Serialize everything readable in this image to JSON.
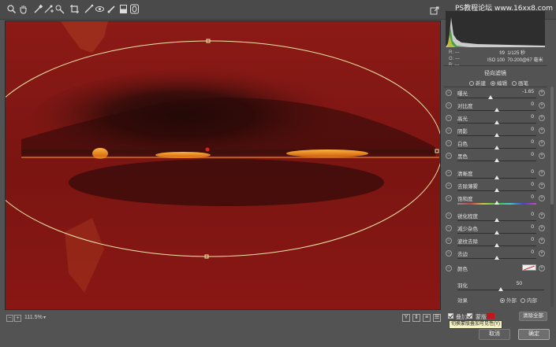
{
  "toolbar": {
    "tools": [
      {
        "icon": "zoom-icon"
      },
      {
        "icon": "hand-icon"
      },
      {
        "icon": "white-balance-icon"
      },
      {
        "icon": "color-sampler-icon"
      },
      {
        "icon": "crop-icon"
      },
      {
        "icon": "straighten-icon"
      },
      {
        "icon": "redeye-icon"
      },
      {
        "icon": "brush-icon"
      },
      {
        "icon": "gradient-filter-icon"
      },
      {
        "icon": "radial-filter-icon"
      }
    ],
    "watermark": "PS教程论坛 www.16xx8.com"
  },
  "info": {
    "r_label": "R:",
    "g_label": "G:",
    "b_label": "B:",
    "r_value": "---",
    "g_value": "---",
    "b_value": "---",
    "aperture": "f/9",
    "shutter": "1/125 秒",
    "iso": "ISO 100",
    "lens": "70-200@67 毫米"
  },
  "panel": {
    "title": "径向滤镜",
    "modes": [
      {
        "label": "新建",
        "selected": false
      },
      {
        "label": "编辑",
        "selected": true
      },
      {
        "label": "画笔",
        "selected": false
      }
    ],
    "sliders": [
      {
        "label": "曝光",
        "value": "-1.65",
        "pos": 0.42
      },
      {
        "label": "对比度",
        "value": "0",
        "pos": 0.5
      },
      {
        "label": "高光",
        "value": "0",
        "pos": 0.5
      },
      {
        "label": "阴影",
        "value": "0",
        "pos": 0.5
      },
      {
        "label": "白色",
        "value": "0",
        "pos": 0.5
      },
      {
        "label": "黑色",
        "value": "0",
        "pos": 0.5
      },
      {
        "label": "清晰度",
        "value": "0",
        "pos": 0.5
      },
      {
        "label": "去除薄雾",
        "value": "0",
        "pos": 0.5
      },
      {
        "label": "饱和度",
        "value": "0",
        "pos": 0.5
      },
      {
        "label": "锐化程度",
        "value": "0",
        "pos": 0.5
      },
      {
        "label": "减少杂色",
        "value": "0",
        "pos": 0.5
      },
      {
        "label": "波纹去除",
        "value": "0",
        "pos": 0.5
      },
      {
        "label": "去边",
        "value": "0",
        "pos": 0.5
      }
    ],
    "color_label": "颜色",
    "feather_label": "羽化",
    "feather_value": "50",
    "feather_pos": 0.5,
    "effect_label": "效果",
    "effect_outside": "外部",
    "effect_inside": "内部",
    "effect_outside_selected": true
  },
  "bottom": {
    "overlay_label": "叠加",
    "mask_label": "蒙版",
    "clear_label": "清除全部",
    "tooltip": "切换蒙版叠加可见性(Y)",
    "mask_color": "#c0161b"
  },
  "status": {
    "zoom": "111.5%",
    "view_y": "Y"
  },
  "dialog": {
    "cancel": "取消",
    "ok": "确定"
  },
  "colors": {
    "overlay": "#8a1714",
    "ellipse": "#f2e6a8",
    "pin": "#e02020"
  }
}
